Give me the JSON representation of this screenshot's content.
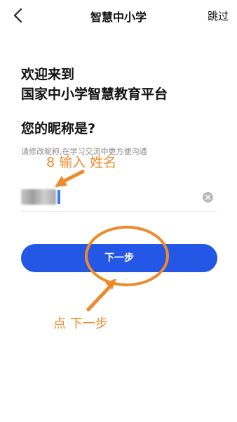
{
  "nav": {
    "title": "智慧中小学",
    "skip_label": "跳过"
  },
  "welcome": {
    "line1": "欢迎来到",
    "line2": "国家中小学智慧教育平台"
  },
  "question": "您的昵称是?",
  "hint": "请修改昵称,在学习交流中更方便沟通",
  "nickname": {
    "value_blurred": true
  },
  "next_button_label": "下一步",
  "annotations": {
    "step_note": "8 输入 姓名",
    "next_note": "点 下一步",
    "color": "#ef8a2a"
  },
  "colors": {
    "primary": "#2457e6",
    "caret": "#3b7bf0"
  }
}
